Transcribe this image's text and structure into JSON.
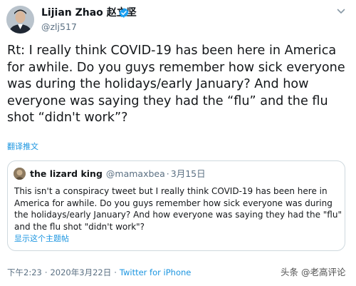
{
  "author": {
    "name": "Lijian Zhao",
    "name_zh": "赵立坚",
    "handle": "@zlj517",
    "verified": true
  },
  "tweet": {
    "text": "Rt: I really think COVID-19 has been here in America for awhile. Do you guys remember how sick everyone was during the holidays/early January? And how everyone was saying they had the “flu” and the flu shot “didn't work”?",
    "translate_label": "翻译推文",
    "time": "下午2:23",
    "date": "2020年3月22日",
    "source": "Twitter for iPhone"
  },
  "quoted": {
    "name": "the lizard king",
    "handle": "@mamaxbea",
    "date": "3月15日",
    "text": "This isn't a conspiracy tweet but I really think COVID-19 has been here in America for awhile. Do you guys remember how sick everyone was during the holidays/early January? And how everyone was saying they had the \"flu\" and the flu shot \"didn't work\"?",
    "thread_label": "显示这个主题帖"
  },
  "watermark": "头条 @老高评论",
  "colors": {
    "link": "#1b95e0",
    "verified": "#1da1f2",
    "muted": "#5b7083",
    "border": "#cfd9de"
  },
  "icons": {
    "verified": "verified-badge-icon",
    "caret": "chevron-down-icon"
  }
}
